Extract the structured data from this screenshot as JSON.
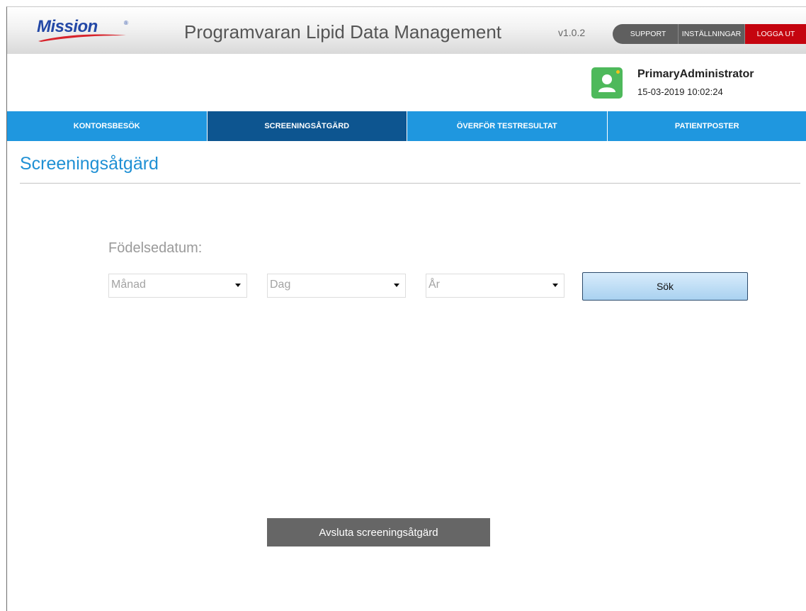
{
  "header": {
    "logo_text": "Mission",
    "logo_reg": "®",
    "app_title": "Programvaran Lipid Data Management",
    "version": "v1.0.2",
    "buttons": {
      "support": "SUPPORT",
      "settings": "INSTÄLLNINGAR",
      "logout": "LOGGA UT"
    }
  },
  "user": {
    "name": "PrimaryAdministrator",
    "datetime": "15-03-2019 10:02:24",
    "avatar_icon": "user-avatar-icon",
    "avatar_color": "#4eb95b"
  },
  "tabs": [
    {
      "label": "KONTORSBESÖK",
      "active": false
    },
    {
      "label": "SCREENINGSÅTGÄRD",
      "active": true
    },
    {
      "label": "ÖVERFÖR TESTRESULTAT",
      "active": false
    },
    {
      "label": "PATIENTPOSTER",
      "active": false
    }
  ],
  "page": {
    "title": "Screeningsåtgärd",
    "dob_label": "Födelsedatum:",
    "month_select": "Månad",
    "day_select": "Dag",
    "year_select": "År",
    "search_label": "Sök",
    "exit_label": "Avsluta screeningsåtgärd"
  },
  "colors": {
    "tab_bar": "#1f97df",
    "tab_active": "#0d5590",
    "logout": "#c5040f",
    "title": "#1f90d4"
  }
}
